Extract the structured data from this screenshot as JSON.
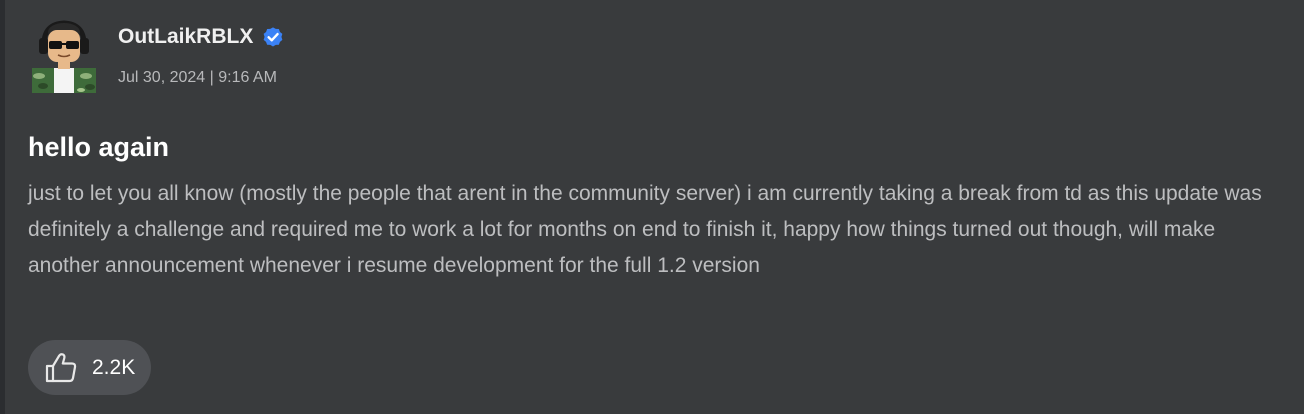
{
  "author": {
    "name": "OutLaikRBLX",
    "verified": true,
    "timestamp": "Jul 30, 2024 | 9:16 AM"
  },
  "post": {
    "title": "hello again",
    "body": "just to let you all know (mostly the people that arent in the community server) i am currently taking a break from td as this update was definitely a challenge and required me to work a lot for months on end to finish it, happy how things turned out though, will make another announcement whenever i resume development for the full 1.2 version"
  },
  "reactions": {
    "like_icon": "thumbs-up-icon",
    "like_count": "2.2K"
  },
  "colors": {
    "background": "#393b3d",
    "verified_badge": "#3b82f6",
    "like_button": "#4f5155"
  }
}
